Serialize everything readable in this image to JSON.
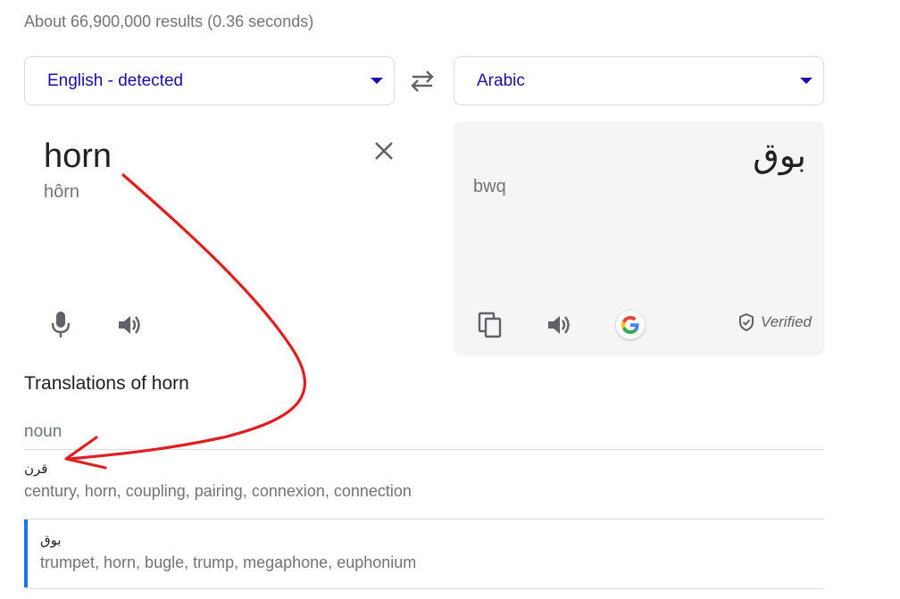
{
  "result_stats": "About 66,900,000 results (0.36 seconds)",
  "source_language": "English - detected",
  "target_language": "Arabic",
  "source": {
    "text": "horn",
    "transliteration": "hôrn"
  },
  "target": {
    "text": "بوق",
    "transliteration": "bwq",
    "verified_label": "Verified"
  },
  "translations": {
    "title": "Translations of horn",
    "part_of_speech": "noun",
    "entries": [
      {
        "word": "قرن",
        "synonyms": "century, horn, coupling, pairing, connexion, connection"
      },
      {
        "word": "بوق",
        "synonyms": "trumpet, horn, bugle, trump, megaphone, euphonium"
      }
    ]
  },
  "colors": {
    "link": "#1a0dab",
    "accent": "#1a73e8",
    "annotation": "#e02020",
    "target_panel": "#f5f5f5"
  },
  "icons": [
    "swap-icon",
    "close-icon",
    "microphone-icon",
    "speaker-icon",
    "copy-icon",
    "google-icon",
    "shield-check-icon"
  ]
}
